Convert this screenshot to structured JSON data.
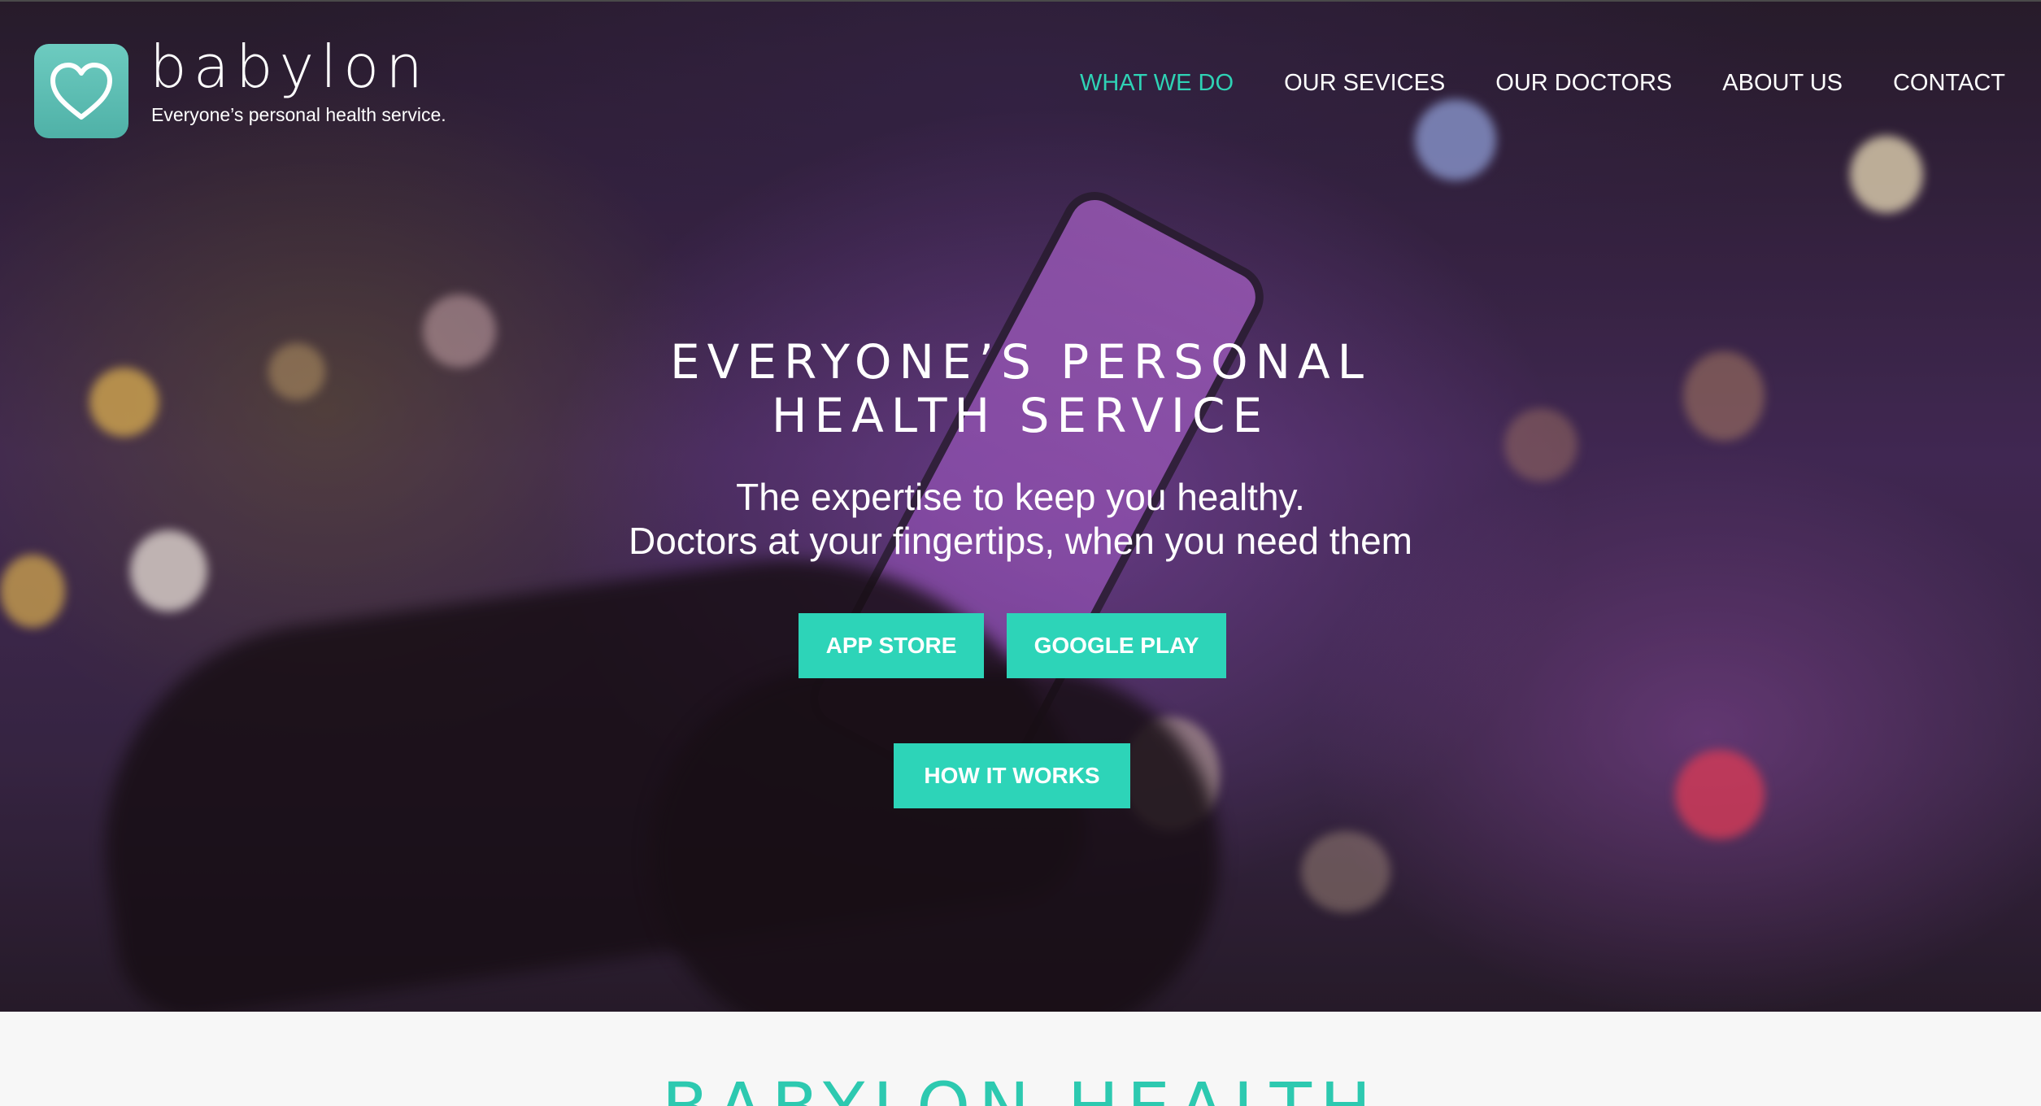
{
  "brand": {
    "name": "babylon",
    "tagline": "Everyone’s personal health service."
  },
  "nav": {
    "items": [
      {
        "label": "WHAT WE DO",
        "active": true
      },
      {
        "label": "OUR SEVICES",
        "active": false
      },
      {
        "label": "OUR DOCTORS",
        "active": false
      },
      {
        "label": "ABOUT US",
        "active": false
      },
      {
        "label": "CONTACT",
        "active": false
      }
    ]
  },
  "hero": {
    "title_line1": "EVERYONE’S PERSONAL",
    "title_line2": "HEALTH SERVICE",
    "subtitle_line1": "The expertise to keep you healthy.",
    "subtitle_line2": "Doctors at your fingertips, when you need them",
    "buttons": {
      "app_store": "APP STORE",
      "google_play": "GOOGLE PLAY",
      "how_it_works": "HOW IT WORKS"
    }
  },
  "section": {
    "heading": "BABYLON HEALTH"
  },
  "colors": {
    "accent": "#2dd4b8",
    "nav_active": "#2fd2b5",
    "logo_bg": "#5fbfb5",
    "section_bg": "#f7f7f7"
  },
  "icons": {
    "logo": "heart-icon"
  }
}
